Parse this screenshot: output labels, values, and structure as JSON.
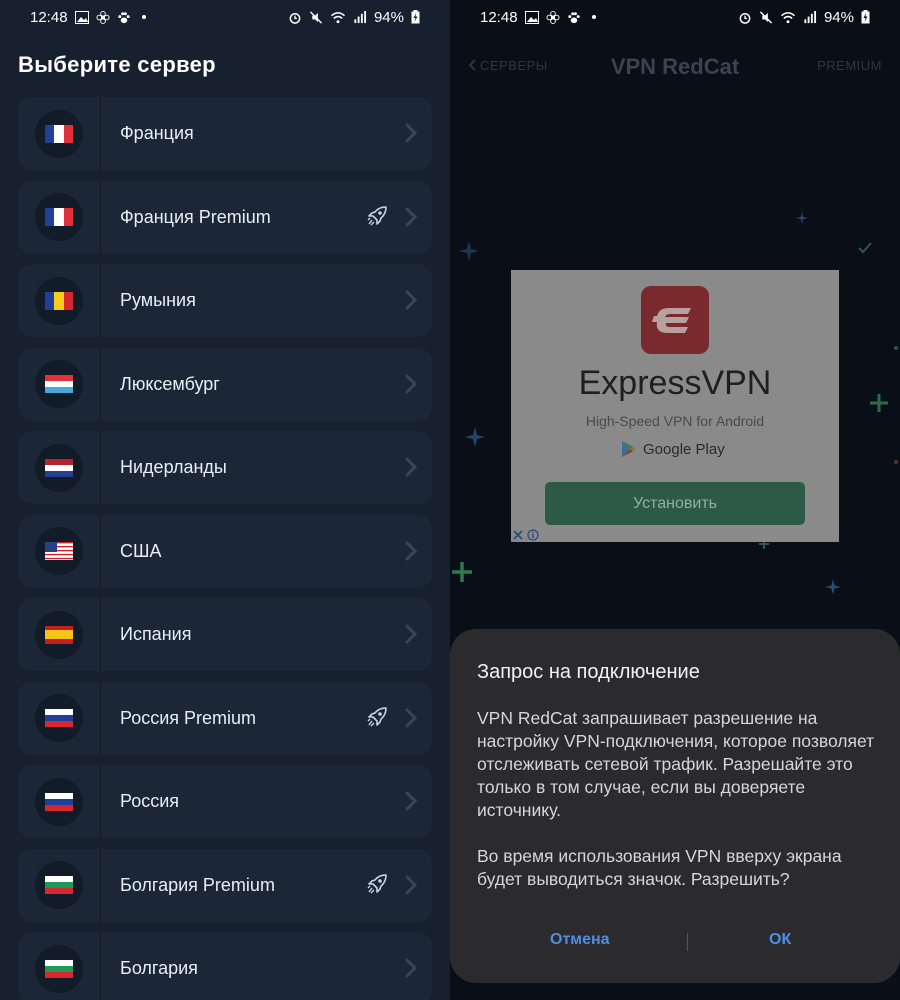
{
  "status_bar": {
    "time": "12:48",
    "battery": "94%"
  },
  "left": {
    "title": "Выберите сервер",
    "servers": [
      {
        "name": "Франция",
        "flag": "france",
        "premium": false
      },
      {
        "name": "Франция Premium",
        "flag": "france",
        "premium": true
      },
      {
        "name": "Румыния",
        "flag": "romania",
        "premium": false
      },
      {
        "name": "Люксембург",
        "flag": "luxembourg",
        "premium": false
      },
      {
        "name": "Нидерланды",
        "flag": "netherlands",
        "premium": false
      },
      {
        "name": "США",
        "flag": "usa",
        "premium": false
      },
      {
        "name": "Испания",
        "flag": "spain",
        "premium": false
      },
      {
        "name": "Россия Premium",
        "flag": "russia",
        "premium": true
      },
      {
        "name": "Россия",
        "flag": "russia",
        "premium": false
      },
      {
        "name": "Болгария Premium",
        "flag": "bulgaria",
        "premium": true
      },
      {
        "name": "Болгария",
        "flag": "bulgaria",
        "premium": false
      }
    ]
  },
  "right": {
    "nav": {
      "back_label": "СЕРВЕРЫ",
      "title": "VPN RedCat",
      "premium_label": "PREMIUM"
    },
    "ad": {
      "brand": "ExpressVPN",
      "subtitle": "High-Speed VPN for Android",
      "store": "Google Play",
      "install_label": "Установить",
      "brand_color": "#da3940"
    },
    "dialog": {
      "title": "Запрос на подключение",
      "paragraph1": "VPN RedCat запрашивает разрешение на настройку VPN-подключения, которое позволяет отслеживать сетевой трафик. Разрешайте это только в том случае, если вы доверяете источнику.",
      "paragraph2": "Во время использования VPN вверху экрана будет выводиться значок. Разрешить?",
      "cancel_label": "Отмена",
      "ok_label": "ОК",
      "accent_color": "#4e8ee6"
    }
  }
}
